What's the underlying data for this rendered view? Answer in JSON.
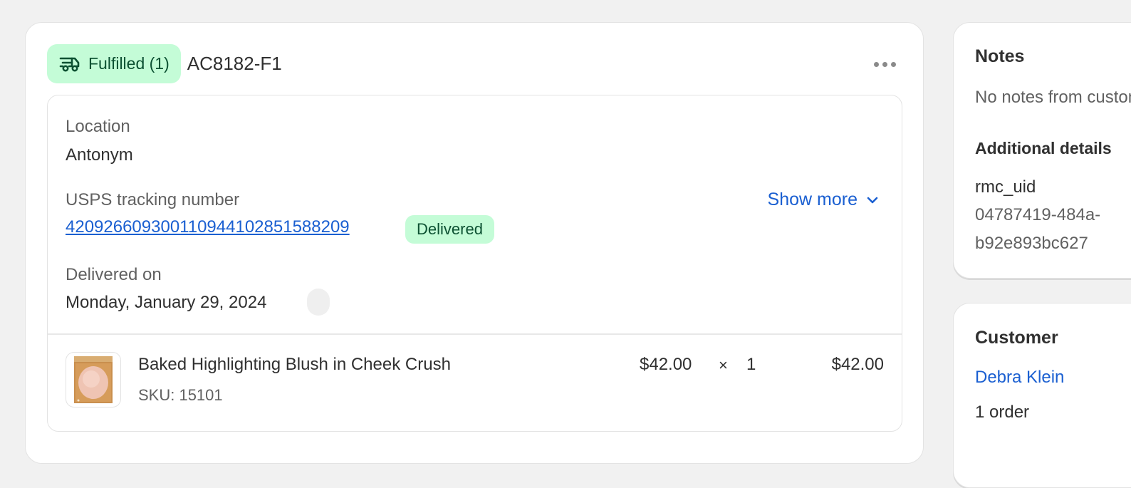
{
  "fulfillment": {
    "status_label": "Fulfilled (1)",
    "status_icon": "delivery-truck-icon",
    "id": "AC8182-F1",
    "more_actions_icon": "horizontal-dots-icon",
    "location_label": "Location",
    "location_value": "Antonym",
    "tracking_label": "USPS tracking number",
    "tracking_number": "420926609300110944102851588209",
    "tracking_status": "Delivered",
    "show_more_label": "Show more",
    "show_more_icon": "chevron-down-icon",
    "delivered_on_label": "Delivered on",
    "delivered_on_value": "Monday, January 29, 2024",
    "line_items": [
      {
        "title": "Baked Highlighting Blush in Cheek Crush",
        "sku": "SKU: 15101",
        "unit_price": "$42.00",
        "times": "×",
        "quantity": "1",
        "total": "$42.00"
      }
    ]
  },
  "notes": {
    "title": "Notes",
    "empty_text": "No notes from customer",
    "additional_details_title": "Additional details",
    "detail_key": "rmc_uid",
    "detail_value_line1": "04787419-484a-",
    "detail_value_line2": "b92e893bc627"
  },
  "customer": {
    "title": "Customer",
    "name": "Debra Klein",
    "orders": "1 order"
  },
  "colors": {
    "success_bg": "#c4fcd7",
    "success_text": "#0c5132",
    "link": "#1a5fd1",
    "page_bg": "#f1f1f1"
  }
}
